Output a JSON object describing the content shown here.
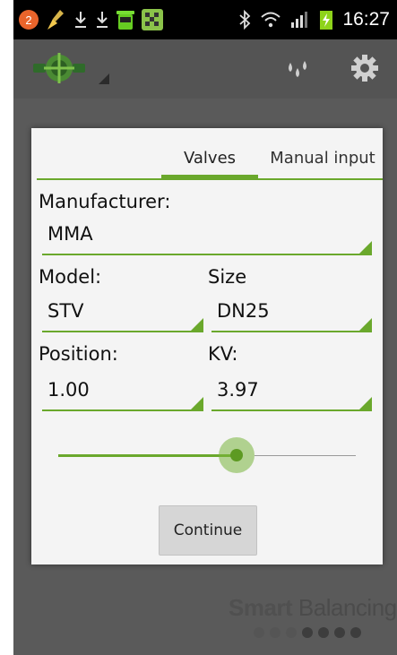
{
  "status_bar": {
    "time": "16:27",
    "notification_badge": "2",
    "icons": [
      "orange-badge-icon",
      "broom-icon",
      "download-icon",
      "download-icon",
      "trash-green-icon",
      "checker-app-icon",
      "bluetooth-icon",
      "wifi-icon",
      "signal-icon",
      "battery-icon"
    ]
  },
  "action_bar": {
    "logo_icon": "valve-logo-icon",
    "actions": [
      "water-drops-icon",
      "gear-icon"
    ]
  },
  "dialog": {
    "tabs": {
      "valves": "Valves",
      "manual": "Manual input",
      "active": "Valves"
    },
    "manufacturer_label": "Manufacturer:",
    "manufacturer_value": "MMA",
    "model_label": "Model:",
    "model_value": "STV",
    "size_label": "Size",
    "size_value": "DN25",
    "position_label": "Position:",
    "position_value": "1.00",
    "kv_label": "KV:",
    "kv_value": "3.97",
    "slider_fraction": 0.6,
    "continue_label": "Continue"
  },
  "footer": {
    "brand_bold": "Smart",
    "brand_rest": " Balancing",
    "page_dots": 7,
    "active_dots": [
      3,
      4,
      5,
      6
    ]
  },
  "colors": {
    "accent": "#6aa82c",
    "statusbar": "#000000",
    "actionbar": "#545454",
    "background": "#5a5a5a",
    "dialog": "#f4f4f4"
  }
}
